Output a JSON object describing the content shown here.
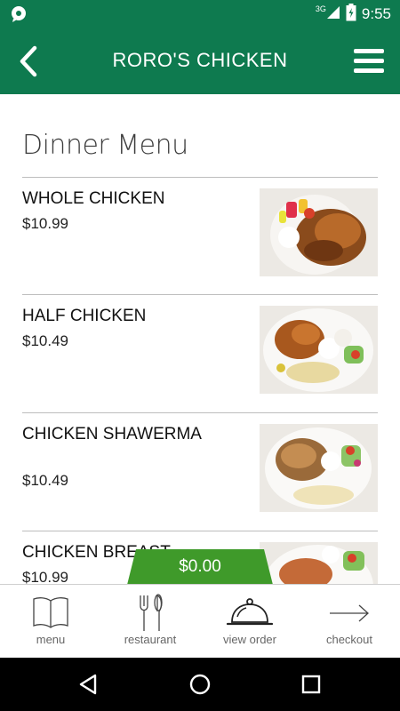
{
  "status_bar": {
    "time": "9:55",
    "network": "3G",
    "left_icon": "notification-icon",
    "icons": [
      "signal-icon",
      "battery-icon"
    ]
  },
  "app_bar": {
    "title": "RORO'S CHICKEN",
    "back_icon": "back-arrow-icon",
    "menu_icon": "hamburger-menu-icon"
  },
  "menu": {
    "section_title": "Dinner Menu",
    "items": [
      {
        "name": "WHOLE CHICKEN",
        "price": "$10.99"
      },
      {
        "name": "HALF CHICKEN",
        "price": "$10.49"
      },
      {
        "name": "CHICKEN SHAWERMA",
        "price": "$10.49"
      },
      {
        "name": "CHICKEN BREAST",
        "price": "$10.99"
      }
    ]
  },
  "order_total": "$0.00",
  "bottom_nav": [
    {
      "label": "menu",
      "icon": "book-icon"
    },
    {
      "label": "restaurant",
      "icon": "fork-knife-icon"
    },
    {
      "label": "view order",
      "icon": "cloche-icon"
    },
    {
      "label": "checkout",
      "icon": "arrow-right-icon"
    }
  ],
  "system_nav": [
    "back-triangle-icon",
    "home-circle-icon",
    "recents-square-icon"
  ],
  "colors": {
    "primary": "#0e7a4f",
    "total_pill": "#3f9a2a",
    "text": "#111111"
  }
}
